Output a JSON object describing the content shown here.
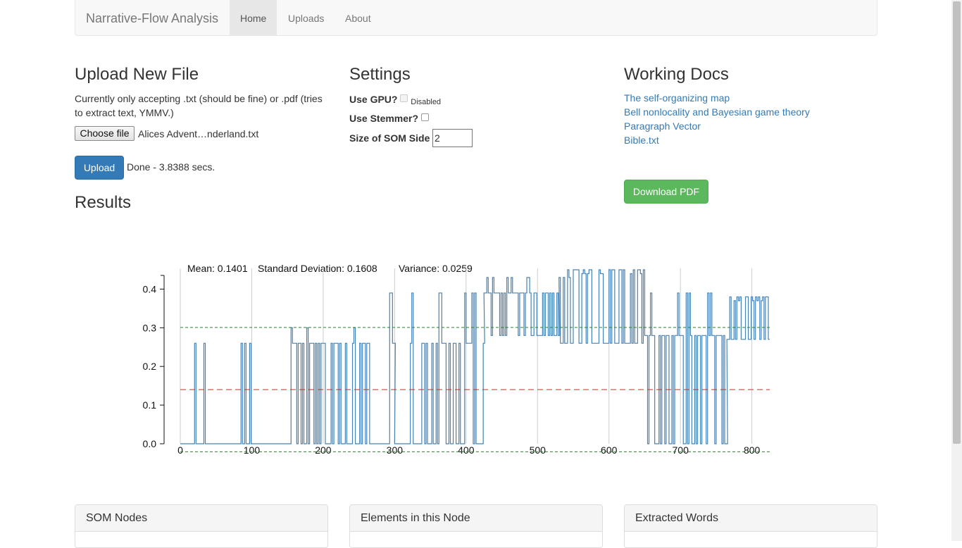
{
  "nav": {
    "brand": "Narrative-Flow Analysis",
    "items": [
      {
        "label": "Home",
        "active": true
      },
      {
        "label": "Uploads",
        "active": false
      },
      {
        "label": "About",
        "active": false
      }
    ]
  },
  "upload": {
    "title": "Upload New File",
    "description": "Currently only accepting .txt (should be fine) or .pdf (tries to extract text, YMMV.)",
    "choose_label": "Choose file",
    "filename": "Alices Advent…nderland.txt",
    "upload_label": "Upload",
    "status": "Done - 3.8388 secs."
  },
  "settings": {
    "title": "Settings",
    "gpu_label": "Use GPU?",
    "gpu_note": "Disabled",
    "stemmer_label": "Use Stemmer?",
    "som_label": "Size of SOM Side",
    "som_value": "2"
  },
  "docs": {
    "title": "Working Docs",
    "links": [
      "The self-organizing map",
      "Bell nonlocality and Bayesian game theory",
      "Paragraph Vector",
      "Bible.txt"
    ],
    "download_label": "Download PDF"
  },
  "results": {
    "title": "Results",
    "stats": {
      "mean": "Mean: 0.1401",
      "std": "Standard Deviation: 0.1608",
      "variance": "Variance: 0.0259"
    }
  },
  "panels": [
    "SOM Nodes",
    "Elements in this Node",
    "Extracted Words"
  ],
  "chart_data": {
    "type": "line",
    "x_range": [
      0,
      825
    ],
    "ylim": [
      0,
      0.45
    ],
    "x_ticks": [
      0,
      100,
      200,
      300,
      400,
      500,
      600,
      700,
      800
    ],
    "y_ticks": [
      0.0,
      0.1,
      0.2,
      0.3,
      0.4
    ],
    "mean_line": 0.1401,
    "upper_band": 0.3009,
    "lower_band": -0.0207,
    "colors": {
      "series": "#4682b4",
      "mean": "#d62728",
      "band": "#2e7d32"
    },
    "segments": [
      [
        0,
        20,
        0
      ],
      [
        20,
        22,
        0.26
      ],
      [
        22,
        33,
        0
      ],
      [
        33,
        35,
        0.26
      ],
      [
        35,
        85,
        0
      ],
      [
        85,
        87,
        0.26
      ],
      [
        87,
        90,
        0
      ],
      [
        90,
        92,
        0.26
      ],
      [
        92,
        97,
        0
      ],
      [
        97,
        99,
        0.26
      ],
      [
        99,
        153,
        0
      ],
      [
        153,
        265,
        "dense",
        0.26,
        0,
        0.3,
        11
      ],
      [
        265,
        293,
        0
      ],
      [
        293,
        300,
        "dense",
        0.26,
        0.39,
        0.3,
        12
      ],
      [
        300,
        322,
        0
      ],
      [
        322,
        425,
        "dense",
        0.26,
        0,
        0.39,
        23
      ],
      [
        425,
        530,
        "dense",
        0.28,
        0.39,
        0.43,
        37
      ],
      [
        530,
        560,
        "dense",
        0.45,
        0.26,
        0.43,
        43
      ],
      [
        560,
        650,
        "dense",
        0.26,
        0.45,
        0.44,
        29
      ],
      [
        650,
        765,
        "dense",
        0.28,
        0,
        0.39,
        53
      ],
      [
        765,
        825,
        "dense",
        0.38,
        0.27,
        0.37,
        61
      ]
    ]
  }
}
